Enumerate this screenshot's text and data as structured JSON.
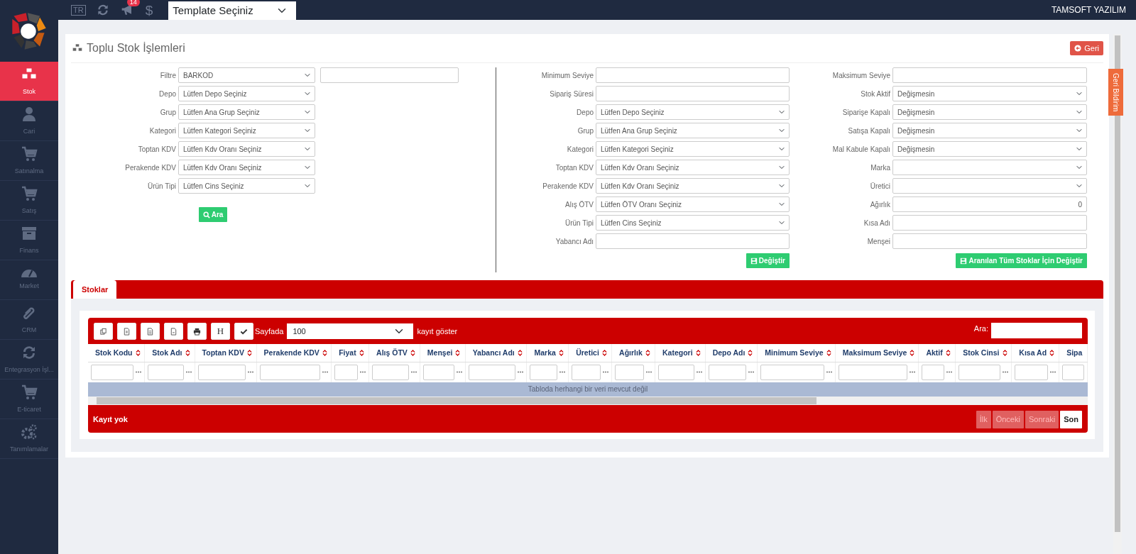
{
  "topbar": {
    "language": "TR",
    "notification_count": "14",
    "currency": "$",
    "template_select": {
      "value": "Template Seçiniz"
    },
    "user": "TAMSOFT YAZILIM"
  },
  "sidebar": {
    "items": [
      {
        "label": "Stok",
        "selected": true
      },
      {
        "label": "Cari",
        "selected": false
      },
      {
        "label": "Satınalma",
        "selected": false
      },
      {
        "label": "Satış",
        "selected": false
      },
      {
        "label": "Finans",
        "selected": false
      },
      {
        "label": "Market",
        "selected": false
      },
      {
        "label": "CRM",
        "selected": false
      },
      {
        "label": "Entegrasyon İşl...",
        "selected": false
      },
      {
        "label": "E-ticaret",
        "selected": false
      },
      {
        "label": "Tanımlamalar",
        "selected": false
      }
    ]
  },
  "page": {
    "title": "Toplu Stok İşlemleri",
    "back_button": "Geri",
    "feedback_tab": "Geri Bildirim"
  },
  "filter_form": {
    "fields": [
      {
        "label": "Filtre",
        "kind": "select",
        "value": "BARKOD",
        "has_text_input": true
      },
      {
        "label": "Depo",
        "kind": "select",
        "value": "Lütfen Depo Seçiniz",
        "has_text_input": false
      },
      {
        "label": "Grup",
        "kind": "select",
        "value": "Lütfen Ana Grup Seçiniz",
        "has_text_input": false
      },
      {
        "label": "Kategori",
        "kind": "select",
        "value": "Lütfen Kategori Seçiniz",
        "has_text_input": false
      },
      {
        "label": "Toptan KDV",
        "kind": "select",
        "value": "Lütfen Kdv Oranı Seçiniz",
        "has_text_input": false
      },
      {
        "label": "Perakende KDV",
        "kind": "select",
        "value": "Lütfen Kdv Oranı Seçiniz",
        "has_text_input": false
      },
      {
        "label": "Ürün Tipi",
        "kind": "select",
        "value": "Lütfen Cins Seçiniz",
        "has_text_input": false
      }
    ],
    "button": "Ara"
  },
  "edit_form": {
    "columns": [
      {
        "fields": [
          {
            "label": "Minimum Seviye",
            "kind": "text"
          },
          {
            "label": "Sipariş Süresi",
            "kind": "text"
          },
          {
            "label": "Depo",
            "kind": "select",
            "value": "Lütfen Depo Seçiniz"
          },
          {
            "label": "Grup",
            "kind": "select",
            "value": "Lütfen Ana Grup Seçiniz"
          },
          {
            "label": "Kategori",
            "kind": "select",
            "value": "Lütfen Kategori Seçiniz"
          },
          {
            "label": "Toptan KDV",
            "kind": "select",
            "value": "Lütfen Kdv Oranı Seçiniz"
          },
          {
            "label": "Perakende KDV",
            "kind": "select",
            "value": "Lütfen Kdv Oranı Seçiniz"
          },
          {
            "label": "Alış ÖTV",
            "kind": "select",
            "value": "Lütfen ÖTV Oranı Seçiniz"
          },
          {
            "label": "Ürün Tipi",
            "kind": "select",
            "value": "Lütfen Cins Seçiniz"
          },
          {
            "label": "Yabancı Adı",
            "kind": "text"
          }
        ],
        "button": "Değiştir"
      },
      {
        "fields": [
          {
            "label": "Maksimum Seviye",
            "kind": "text"
          },
          {
            "label": "Stok Aktif",
            "kind": "select",
            "value": "Değişmesin"
          },
          {
            "label": "Siparişe Kapalı",
            "kind": "select",
            "value": "Değişmesin"
          },
          {
            "label": "Satışa Kapalı",
            "kind": "select",
            "value": "Değişmesin"
          },
          {
            "label": "Mal Kabule Kapalı",
            "kind": "select",
            "value": "Değişmesin"
          },
          {
            "label": "Marka",
            "kind": "select"
          },
          {
            "label": "Üretici",
            "kind": "select"
          },
          {
            "label": "Ağırlık",
            "kind": "number",
            "value": "0"
          },
          {
            "label": "Kısa Adı",
            "kind": "text"
          },
          {
            "label": "Menşei",
            "kind": "text"
          }
        ],
        "button": "Aranılan Tüm Stoklar İçin Değiştir"
      }
    ]
  },
  "tabs": [
    {
      "label": "Stoklar",
      "selected": true
    }
  ],
  "table": {
    "toolbar_text_button": "H",
    "per_page_label": "Sayfada",
    "per_page_value": "100",
    "per_page_suffix": "kayıt göster",
    "search_label": "Ara:",
    "columns": [
      "Stok Kodu",
      "Stok Adı",
      "Toptan KDV",
      "Perakende KDV",
      "Fiyat",
      "Alış ÖTV",
      "Menşei",
      "Yabancı Adı",
      "Marka",
      "Üretici",
      "Ağırlık",
      "Kategori",
      "Depo Adı",
      "Minimum Seviye",
      "Maksimum Seviye",
      "Aktif",
      "Stok Cinsi",
      "Kısa Ad",
      "Sipa"
    ],
    "empty_message": "Tabloda herhangi bir veri mevcut değil",
    "info": "Kayıt yok",
    "pagination": [
      {
        "label": "İlk",
        "disabled": true
      },
      {
        "label": "Önceki",
        "disabled": true
      },
      {
        "label": "Sonraki",
        "disabled": true
      },
      {
        "label": "Son",
        "disabled": false
      }
    ]
  }
}
